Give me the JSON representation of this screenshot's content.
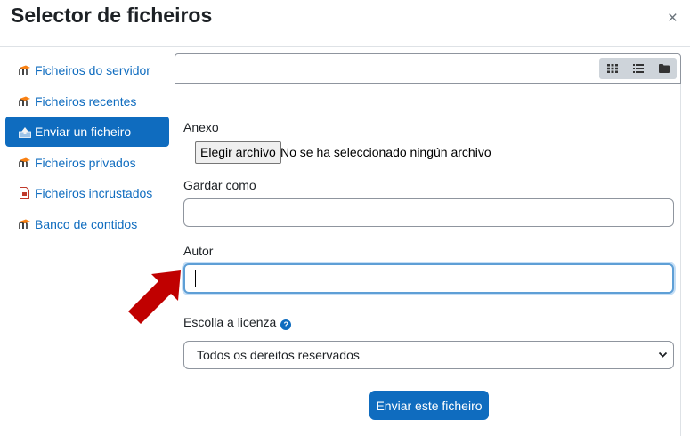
{
  "dialog": {
    "title": "Selector de ficheiros",
    "close_label": "×"
  },
  "sidebar": {
    "items": [
      {
        "label": "Ficheiros do servidor",
        "icon": "moodle-icon",
        "active": false
      },
      {
        "label": "Ficheiros recentes",
        "icon": "moodle-icon",
        "active": false
      },
      {
        "label": "Enviar un ficheiro",
        "icon": "upload-icon",
        "active": true
      },
      {
        "label": "Ficheiros privados",
        "icon": "moodle-icon",
        "active": false
      },
      {
        "label": "Ficheiros incrustados",
        "icon": "document-icon",
        "active": false
      },
      {
        "label": "Banco de contidos",
        "icon": "moodle-icon",
        "active": false
      }
    ]
  },
  "toolbar": {
    "view_icons": [
      "grid-view-icon",
      "list-view-icon",
      "folder-view-icon"
    ]
  },
  "form": {
    "attachment_label": "Anexo",
    "choose_file_button": "Elegir archivo",
    "no_file_text": "No se ha seleccionado ningún archivo",
    "save_as_label": "Gardar como",
    "save_as_value": "",
    "author_label": "Autor",
    "author_value": "",
    "license_label": "Escolla a licenza",
    "license_selected": "Todos os dereitos reservados",
    "submit_button": "Enviar este ficheiro"
  },
  "colors": {
    "accent": "#0f6cbf",
    "moodle_orange": "#f98012",
    "annotation_arrow": "#c00000"
  }
}
